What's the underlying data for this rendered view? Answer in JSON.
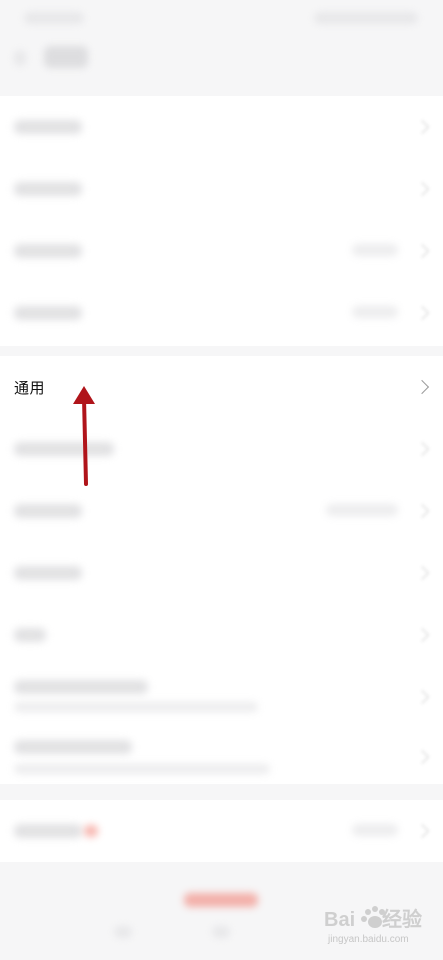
{
  "settings": {
    "general_row": {
      "label": "通用"
    }
  },
  "watermark": {
    "site": "jingyan.baidu.com"
  },
  "colors": {
    "arrow": "#b0141a",
    "background": "#f6f6f7",
    "row": "#ffffff"
  }
}
